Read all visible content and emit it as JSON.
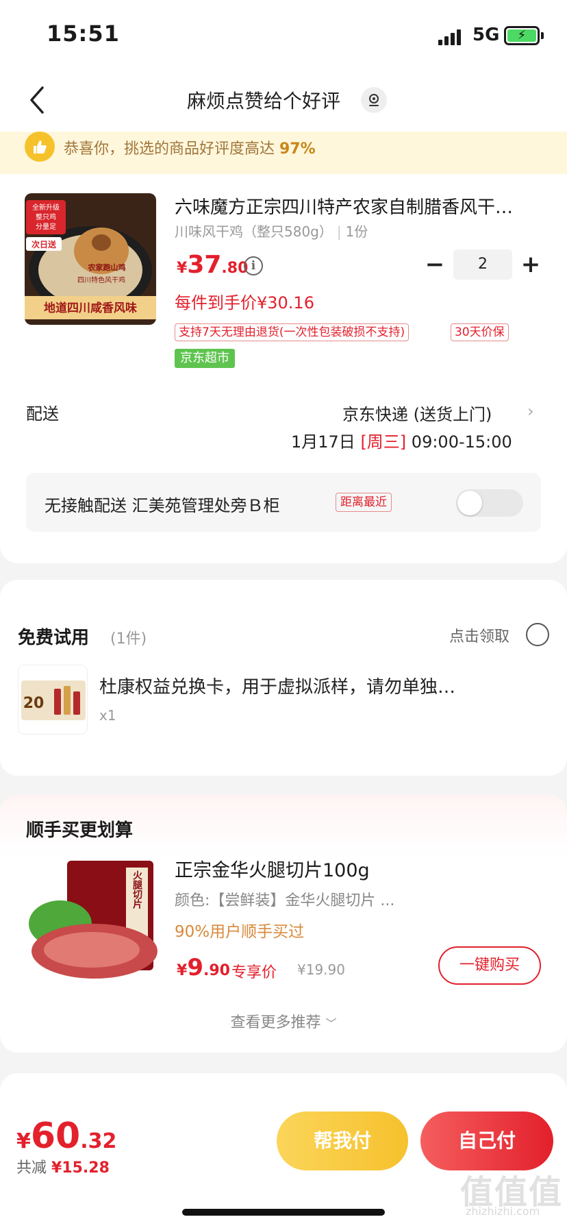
{
  "status_bar": {
    "time": "15:51",
    "network": "5G"
  },
  "header": {
    "title": "麻烦点赞给个好评"
  },
  "banner": {
    "text": "恭喜你，挑选的商品好评度高达 ",
    "percent": "97%"
  },
  "product": {
    "title": "六味魔方正宗四川特产农家自制腊香风干…",
    "spec": "川味风干鸡（整只580g）",
    "count": "1份",
    "price_currency": "¥",
    "price_int": "37",
    "price_dec": ".80",
    "quantity": "2",
    "unit_price": "每件到手价¥30.16",
    "tags": [
      "支持7天无理由退货(一次性包装破损不支持)",
      "30天价保"
    ],
    "store_tag": "京东超市",
    "image_texts": [
      "全新升级",
      "整只鸡",
      "分量足",
      "次日送",
      "农家跑山鸡",
      "四川特色风干鸡",
      "地道四川咸香风味"
    ]
  },
  "shipping": {
    "label": "配送",
    "method": "京东快递 (送货上门)",
    "date": "1月17日 ",
    "weekday": "[周三]",
    "time": " 09:00-15:00",
    "contactless": "无接触配送  汇美苑管理处旁Ｂ柜",
    "nearest_badge": "距离最近"
  },
  "free_trial": {
    "title": "免费试用",
    "count": "(1件)",
    "claim": "点击领取",
    "item_name": "杜康权益兑换卡，用于虚拟派样，请勿单独…",
    "item_qty": "x1",
    "image_text": "20"
  },
  "recommend": {
    "title": "顺手买更划算",
    "name": "正宗金华火腿切片100g",
    "spec": "颜色:【尝鲜装】金华火腿切片 ...",
    "users": "90%用户顺手买过",
    "price_currency": "¥",
    "price_int": "9",
    "price_dec": ".90",
    "exclusive": "专享价",
    "original_price": "¥19.90",
    "buy_button": "一键购买",
    "image_text": "火腿切片",
    "more": "查看更多推荐"
  },
  "footer": {
    "total_currency": "¥",
    "total_int": "60",
    "total_dec": ".32",
    "saved_label": "共减 ",
    "saved_value": "¥15.28",
    "help_pay": "帮我付",
    "self_pay": "自己付"
  },
  "watermark": {
    "main": "值值值",
    "sub": "zhizhizhi.com"
  },
  "colors": {
    "accent_red": "#e3202c",
    "accent_yellow": "#f6c22b",
    "store_green": "#5ec44f"
  }
}
